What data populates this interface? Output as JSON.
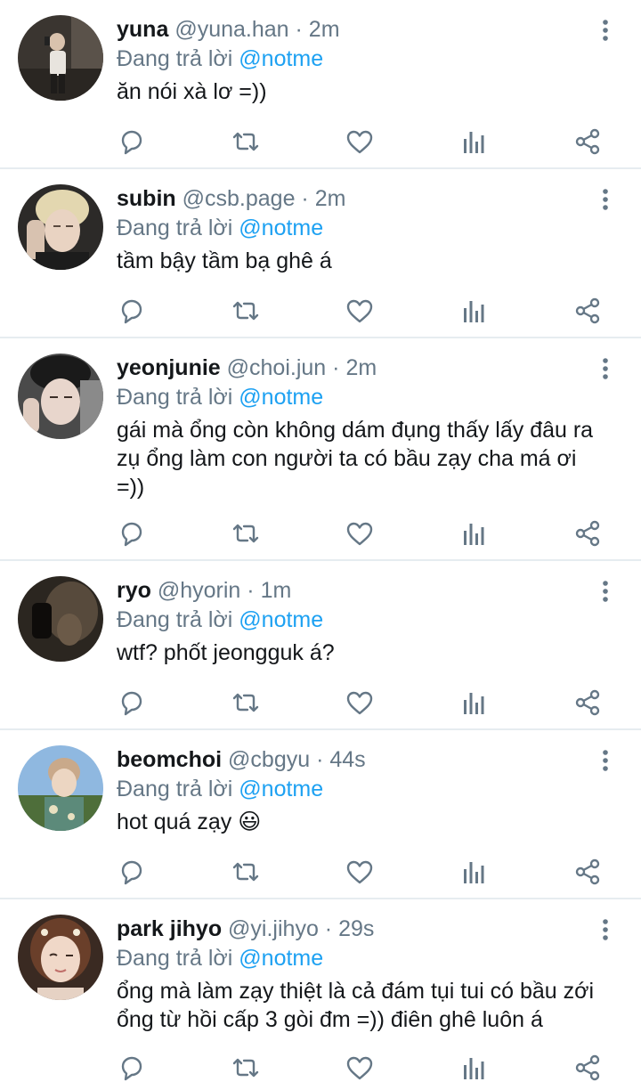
{
  "icons": {
    "reply": "reply-icon",
    "retweet": "retweet-icon",
    "like": "heart-icon",
    "analytics": "analytics-icon",
    "share": "share-icon",
    "menu": "more-vertical-icon"
  },
  "colors": {
    "name": "#14171a",
    "meta": "#657786",
    "mention": "#1da1f2",
    "icon": "#657786",
    "divider": "#e6ecf0"
  },
  "tweets": [
    {
      "name": "yuna",
      "handle": "@yuna.han",
      "dot": "·",
      "time": "2m",
      "reply_prefix": "Đang trả lời",
      "reply_to": "@notme",
      "text": "ăn nói xà lơ =))"
    },
    {
      "name": "subin",
      "handle": "@csb.page",
      "dot": "·",
      "time": "2m",
      "reply_prefix": "Đang trả lời",
      "reply_to": "@notme",
      "text": "tầm bậy tầm bạ ghê á"
    },
    {
      "name": "yeonjunie",
      "handle": "@choi.jun",
      "dot": "·",
      "time": "2m",
      "reply_prefix": "Đang trả lời",
      "reply_to": "@notme",
      "text": "gái mà ổng còn không dám đụng thấy lấy đâu ra zụ ổng làm con người ta có bầu zạy cha má ơi =))"
    },
    {
      "name": "ryo",
      "handle": "@hyorin",
      "dot": "·",
      "time": "1m",
      "reply_prefix": "Đang trả lời",
      "reply_to": "@notme",
      "text": "wtf? phốt jeongguk á?"
    },
    {
      "name": "beomchoi",
      "handle": "@cbgyu",
      "dot": "·",
      "time": "44s",
      "reply_prefix": "Đang trả lời",
      "reply_to": "@notme",
      "text": "hot quá zạy",
      "emoji": "😃"
    },
    {
      "name": "park jihyo",
      "handle": "@yi.jihyo",
      "dot": "·",
      "time": "29s",
      "reply_prefix": "Đang trả lời",
      "reply_to": "@notme",
      "text": "ổng mà làm zạy thiệt là cả đám tụi tui có bầu zới ổng từ hồi cấp 3 gòi đm =)) điên ghê luôn á"
    }
  ]
}
